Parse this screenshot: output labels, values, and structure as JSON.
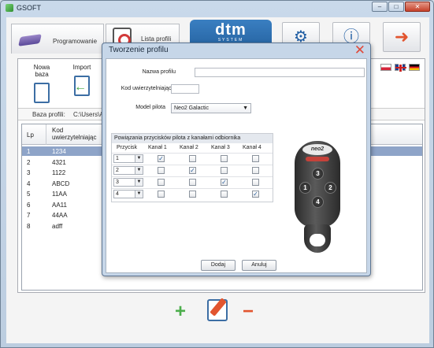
{
  "window": {
    "title": "GSOFT",
    "minimize": "–",
    "maximize": "□",
    "close": "✕"
  },
  "nav": {
    "tab_programowanie": "Programowanie",
    "tab_lista_profili": "Lista profili",
    "logo_main": "dtm",
    "logo_sub": "SYSTEM",
    "icons": [
      "settings-icon",
      "info-icon",
      "exit-icon"
    ]
  },
  "toolbar": {
    "new_base": "Nowa baza",
    "import": "Import"
  },
  "path": {
    "label": "Baza profili:",
    "value": "C:\\Users\\Ann"
  },
  "grid": {
    "col_lp": "Lp",
    "col_kod": "Kod uwierzytelniając",
    "rows": [
      {
        "lp": "1",
        "kod": "1234",
        "selected": true
      },
      {
        "lp": "2",
        "kod": "4321",
        "selected": false
      },
      {
        "lp": "3",
        "kod": "1122",
        "selected": false
      },
      {
        "lp": "4",
        "kod": "ABCD",
        "selected": false
      },
      {
        "lp": "5",
        "kod": "11AA",
        "selected": false
      },
      {
        "lp": "6",
        "kod": "AA11",
        "selected": false
      },
      {
        "lp": "7",
        "kod": "44AA",
        "selected": false
      },
      {
        "lp": "8",
        "kod": "adff",
        "selected": false
      }
    ]
  },
  "dialog": {
    "title": "Tworzenie profilu",
    "close": "✕",
    "profile_name_label": "Nazwa profilu",
    "profile_name_value": "",
    "auth_code_label": "Kod uwierzytelniający",
    "auth_code_value": "",
    "remote_model_label": "Model pilota",
    "remote_model_value": "Neo2 Galactic",
    "binding_header": "Powiązania przycisków pilota z kanałami odbiornika",
    "col_button": "Przycisk",
    "col_ch1": "Kanał 1",
    "col_ch2": "Kanał 2",
    "col_ch3": "Kanał 3",
    "col_ch4": "Kanał 4",
    "bindings": [
      {
        "button": "1",
        "ch": [
          true,
          false,
          false,
          false
        ]
      },
      {
        "button": "2",
        "ch": [
          false,
          true,
          false,
          false
        ]
      },
      {
        "button": "3",
        "ch": [
          false,
          false,
          true,
          false
        ]
      },
      {
        "button": "4",
        "ch": [
          false,
          false,
          false,
          true
        ]
      }
    ],
    "remote_brand": "neo2",
    "remote_keys": [
      "3",
      "1",
      "2",
      "4"
    ],
    "add_button": "Dodaj",
    "cancel_button": "Anuluj"
  },
  "colors": {
    "accent": "#215d9b",
    "selected_row": "#8ea4c8",
    "close_red": "#e04a3a"
  }
}
